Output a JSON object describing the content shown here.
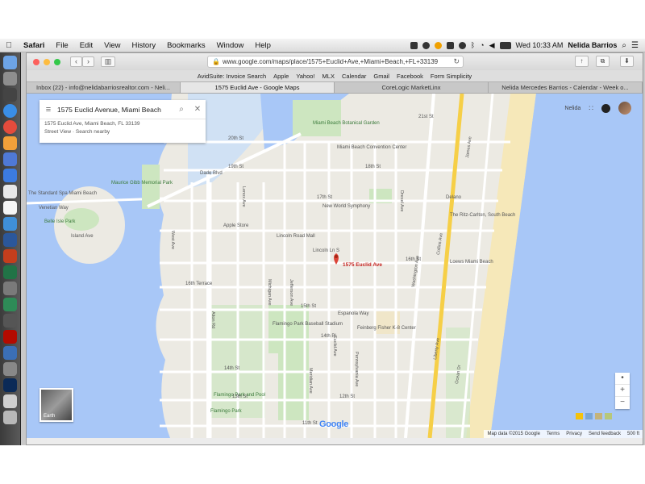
{
  "menubar": {
    "app_name": "Safari",
    "items": [
      "File",
      "Edit",
      "View",
      "History",
      "Bookmarks",
      "Window",
      "Help"
    ],
    "clock": "Wed 10:33 AM",
    "user": "Nelida Barrios"
  },
  "browser": {
    "url": "www.google.com/maps/place/1575+Euclid+Ave,+Miami+Beach,+FL+33139",
    "favorites": [
      "AvidSuite: Invoice Search",
      "Apple",
      "Yahoo!",
      "MLX",
      "Calendar",
      "Gmail",
      "Facebook",
      "Form Simplicity"
    ],
    "tabs": [
      {
        "label": "Inbox (22) - info@nelidabarriosrealtor.com - Neli..."
      },
      {
        "label": "1575 Euclid Ave - Google Maps"
      },
      {
        "label": "CoreLogic MarketLinx"
      },
      {
        "label": "Nelida Mercedes Barrios - Calendar - Week o..."
      }
    ]
  },
  "maps": {
    "search_value": "1575 Euclid Avenue, Miami Beach",
    "address_line": "1575 Euclid Ave, Miami Beach, FL 33139",
    "street_view": "Street View",
    "search_nearby": "Search nearby",
    "account_name": "Nelida",
    "earth_label": "Earth",
    "marker_label": "1575 Euclid Ave",
    "google_logo": "Google",
    "attribution": [
      "Map data ©2015 Google",
      "Terms",
      "Privacy",
      "Send feedback",
      "500 ft"
    ],
    "places": {
      "botanical": "Miami Beach Botanical Garden",
      "convention": "Miami Beach Convention Center",
      "holocaust": "Maurice Gibb Memorial Park",
      "standard_spa": "The Standard Spa Miami Beach",
      "venetian": "Venetian Way",
      "belle_isle": "Belle Isle Park",
      "island_ave": "Island Ave",
      "new_world": "New World Symphony",
      "apple_store": "Apple Store",
      "lincoln_road": "Lincoln Road Mall",
      "lincoln_ln": "Lincoln Ln S",
      "delano": "Delano",
      "ritz": "The Ritz-Carlton, South Beach",
      "loews": "Loews Miami Beach",
      "espanola": "Espanola Way",
      "flamingo_stadium": "Flamingo Park Baseball Stadium",
      "flamingo_pool": "Flamingo Park and Pool",
      "flamingo_park": "Flamingo Park",
      "feinberg": "Feinberg Fisher K-8 Center",
      "dade_blvd": "Dade Blvd",
      "collins": "Collins Ave",
      "washington": "Washington Ave",
      "meridian": "Meridian Ave",
      "pennsylvania": "Pennsylvania Ave",
      "michigan": "Michigan Ave",
      "jefferson": "Jefferson Ave",
      "lenox": "Lenox Ave",
      "alton": "Alton Rd",
      "west": "West Ave",
      "drexel": "Drexel Ave",
      "james": "James Ave",
      "ocean": "Ocean Dr",
      "euclid": "Euclid Ave",
      "liberty": "Liberty Ave",
      "streets": [
        "20th St",
        "19th St",
        "18th St",
        "17th St",
        "16th St",
        "16th Terrace",
        "15th St",
        "14th Pl",
        "14th St",
        "13th St",
        "12th St",
        "11th St",
        "21st St",
        "18th St"
      ]
    }
  }
}
